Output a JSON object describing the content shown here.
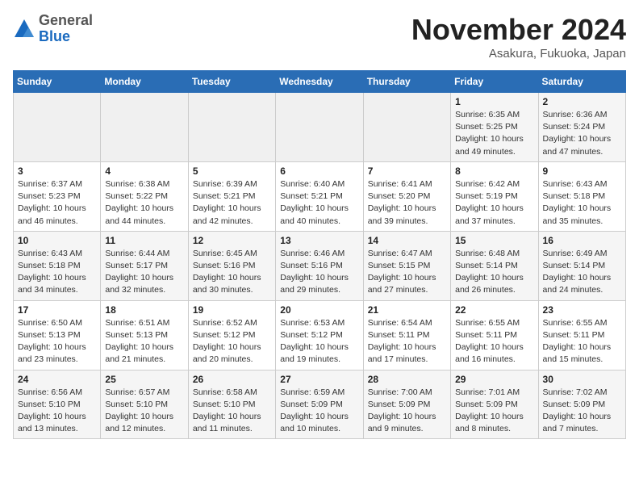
{
  "logo": {
    "general": "General",
    "blue": "Blue"
  },
  "header": {
    "month": "November 2024",
    "location": "Asakura, Fukuoka, Japan"
  },
  "weekdays": [
    "Sunday",
    "Monday",
    "Tuesday",
    "Wednesday",
    "Thursday",
    "Friday",
    "Saturday"
  ],
  "weeks": [
    [
      {
        "day": "",
        "info": ""
      },
      {
        "day": "",
        "info": ""
      },
      {
        "day": "",
        "info": ""
      },
      {
        "day": "",
        "info": ""
      },
      {
        "day": "",
        "info": ""
      },
      {
        "day": "1",
        "info": "Sunrise: 6:35 AM\nSunset: 5:25 PM\nDaylight: 10 hours and 49 minutes."
      },
      {
        "day": "2",
        "info": "Sunrise: 6:36 AM\nSunset: 5:24 PM\nDaylight: 10 hours and 47 minutes."
      }
    ],
    [
      {
        "day": "3",
        "info": "Sunrise: 6:37 AM\nSunset: 5:23 PM\nDaylight: 10 hours and 46 minutes."
      },
      {
        "day": "4",
        "info": "Sunrise: 6:38 AM\nSunset: 5:22 PM\nDaylight: 10 hours and 44 minutes."
      },
      {
        "day": "5",
        "info": "Sunrise: 6:39 AM\nSunset: 5:21 PM\nDaylight: 10 hours and 42 minutes."
      },
      {
        "day": "6",
        "info": "Sunrise: 6:40 AM\nSunset: 5:21 PM\nDaylight: 10 hours and 40 minutes."
      },
      {
        "day": "7",
        "info": "Sunrise: 6:41 AM\nSunset: 5:20 PM\nDaylight: 10 hours and 39 minutes."
      },
      {
        "day": "8",
        "info": "Sunrise: 6:42 AM\nSunset: 5:19 PM\nDaylight: 10 hours and 37 minutes."
      },
      {
        "day": "9",
        "info": "Sunrise: 6:43 AM\nSunset: 5:18 PM\nDaylight: 10 hours and 35 minutes."
      }
    ],
    [
      {
        "day": "10",
        "info": "Sunrise: 6:43 AM\nSunset: 5:18 PM\nDaylight: 10 hours and 34 minutes."
      },
      {
        "day": "11",
        "info": "Sunrise: 6:44 AM\nSunset: 5:17 PM\nDaylight: 10 hours and 32 minutes."
      },
      {
        "day": "12",
        "info": "Sunrise: 6:45 AM\nSunset: 5:16 PM\nDaylight: 10 hours and 30 minutes."
      },
      {
        "day": "13",
        "info": "Sunrise: 6:46 AM\nSunset: 5:16 PM\nDaylight: 10 hours and 29 minutes."
      },
      {
        "day": "14",
        "info": "Sunrise: 6:47 AM\nSunset: 5:15 PM\nDaylight: 10 hours and 27 minutes."
      },
      {
        "day": "15",
        "info": "Sunrise: 6:48 AM\nSunset: 5:14 PM\nDaylight: 10 hours and 26 minutes."
      },
      {
        "day": "16",
        "info": "Sunrise: 6:49 AM\nSunset: 5:14 PM\nDaylight: 10 hours and 24 minutes."
      }
    ],
    [
      {
        "day": "17",
        "info": "Sunrise: 6:50 AM\nSunset: 5:13 PM\nDaylight: 10 hours and 23 minutes."
      },
      {
        "day": "18",
        "info": "Sunrise: 6:51 AM\nSunset: 5:13 PM\nDaylight: 10 hours and 21 minutes."
      },
      {
        "day": "19",
        "info": "Sunrise: 6:52 AM\nSunset: 5:12 PM\nDaylight: 10 hours and 20 minutes."
      },
      {
        "day": "20",
        "info": "Sunrise: 6:53 AM\nSunset: 5:12 PM\nDaylight: 10 hours and 19 minutes."
      },
      {
        "day": "21",
        "info": "Sunrise: 6:54 AM\nSunset: 5:11 PM\nDaylight: 10 hours and 17 minutes."
      },
      {
        "day": "22",
        "info": "Sunrise: 6:55 AM\nSunset: 5:11 PM\nDaylight: 10 hours and 16 minutes."
      },
      {
        "day": "23",
        "info": "Sunrise: 6:55 AM\nSunset: 5:11 PM\nDaylight: 10 hours and 15 minutes."
      }
    ],
    [
      {
        "day": "24",
        "info": "Sunrise: 6:56 AM\nSunset: 5:10 PM\nDaylight: 10 hours and 13 minutes."
      },
      {
        "day": "25",
        "info": "Sunrise: 6:57 AM\nSunset: 5:10 PM\nDaylight: 10 hours and 12 minutes."
      },
      {
        "day": "26",
        "info": "Sunrise: 6:58 AM\nSunset: 5:10 PM\nDaylight: 10 hours and 11 minutes."
      },
      {
        "day": "27",
        "info": "Sunrise: 6:59 AM\nSunset: 5:09 PM\nDaylight: 10 hours and 10 minutes."
      },
      {
        "day": "28",
        "info": "Sunrise: 7:00 AM\nSunset: 5:09 PM\nDaylight: 10 hours and 9 minutes."
      },
      {
        "day": "29",
        "info": "Sunrise: 7:01 AM\nSunset: 5:09 PM\nDaylight: 10 hours and 8 minutes."
      },
      {
        "day": "30",
        "info": "Sunrise: 7:02 AM\nSunset: 5:09 PM\nDaylight: 10 hours and 7 minutes."
      }
    ]
  ]
}
